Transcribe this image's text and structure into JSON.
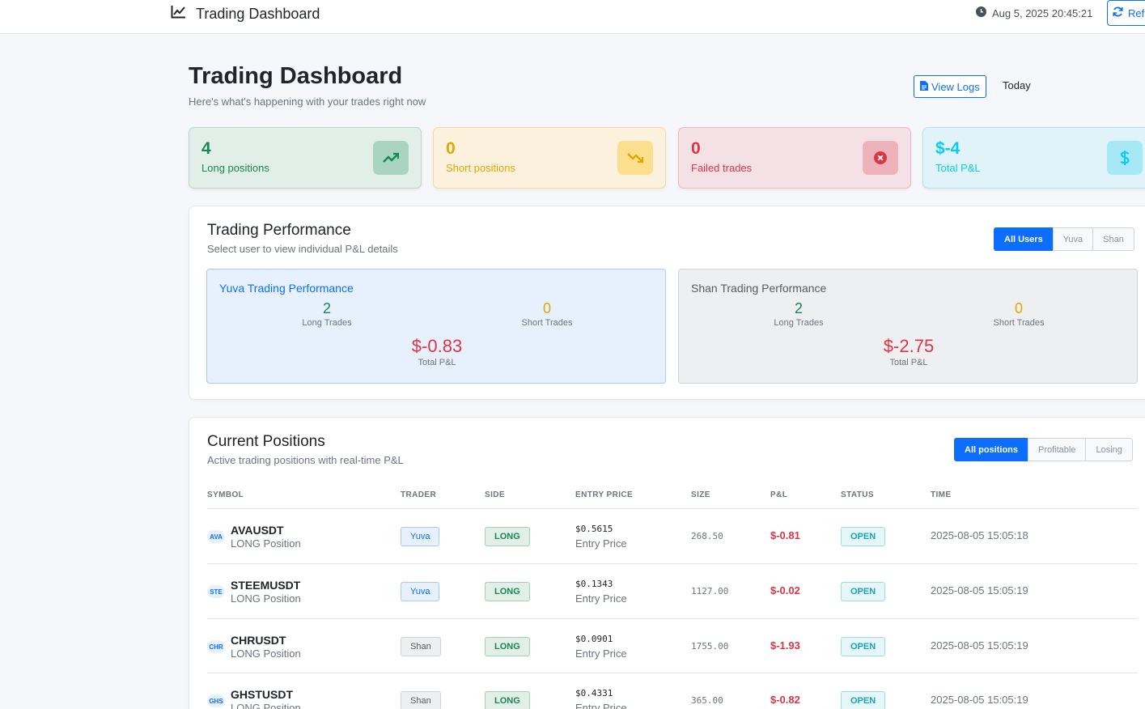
{
  "navbar": {
    "brand": "Trading Dashboard",
    "datetime": "Aug 5, 2025 20:45:21",
    "refresh_label": "Refresh"
  },
  "header": {
    "title": "Trading Dashboard",
    "subtitle": "Here's what's happening with your trades right now",
    "view_logs_label": "View Logs",
    "period": "Today"
  },
  "stats": {
    "long": {
      "value": "4",
      "label": "Long positions",
      "icon": "trending-up-icon"
    },
    "short": {
      "value": "0",
      "label": "Short positions",
      "icon": "trending-down-icon"
    },
    "failed": {
      "value": "0",
      "label": "Failed trades",
      "icon": "x-circle-icon"
    },
    "pnl": {
      "value": "$-4",
      "label": "Total P&L",
      "icon": "dollar-icon"
    }
  },
  "performance": {
    "title": "Trading Performance",
    "subtitle": "Select user to view individual P&L details",
    "filters": [
      "All Users",
      "Yuva",
      "Shan"
    ],
    "active_filter": "All Users",
    "users": {
      "yuva": {
        "title": "Yuva Trading Performance",
        "long_value": "2",
        "long_label": "Long Trades",
        "short_value": "0",
        "short_label": "Short Trades",
        "pnl_value": "$-0.83",
        "pnl_label": "Total P&L"
      },
      "shan": {
        "title": "Shan Trading Performance",
        "long_value": "2",
        "long_label": "Long Trades",
        "short_value": "0",
        "short_label": "Short Trades",
        "pnl_value": "$-2.75",
        "pnl_label": "Total P&L"
      }
    }
  },
  "positions": {
    "title": "Current Positions",
    "subtitle": "Active trading positions with real-time P&L",
    "filters": [
      "All positions",
      "Profitable",
      "Losing"
    ],
    "active_filter": "All positions",
    "columns": [
      "SYMBOL",
      "TRADER",
      "SIDE",
      "ENTRY PRICE",
      "SIZE",
      "P&L",
      "STATUS",
      "TIME"
    ],
    "rows": [
      {
        "icon": "AVA",
        "symbol": "AVAUSDT",
        "sub": "LONG Position",
        "trader": "Yuva",
        "side": "LONG",
        "entry": "$0.5615",
        "entry_sub": "Entry Price",
        "size": "268.50",
        "pnl": "$-0.81",
        "status": "OPEN",
        "time": "2025-08-05 15:05:18"
      },
      {
        "icon": "STE",
        "symbol": "STEEMUSDT",
        "sub": "LONG Position",
        "trader": "Yuva",
        "side": "LONG",
        "entry": "$0.1343",
        "entry_sub": "Entry Price",
        "size": "1127.00",
        "pnl": "$-0.02",
        "status": "OPEN",
        "time": "2025-08-05 15:05:19"
      },
      {
        "icon": "CHR",
        "symbol": "CHRUSDT",
        "sub": "LONG Position",
        "trader": "Shan",
        "side": "LONG",
        "entry": "$0.0901",
        "entry_sub": "Entry Price",
        "size": "1755.00",
        "pnl": "$-1.93",
        "status": "OPEN",
        "time": "2025-08-05 15:05:19"
      },
      {
        "icon": "GHS",
        "symbol": "GHSTUSDT",
        "sub": "LONG Position",
        "trader": "Shan",
        "side": "LONG",
        "entry": "$0.4331",
        "entry_sub": "Entry Price",
        "size": "365.00",
        "pnl": "$-0.82",
        "status": "OPEN",
        "time": "2025-08-05 15:05:19"
      }
    ]
  }
}
